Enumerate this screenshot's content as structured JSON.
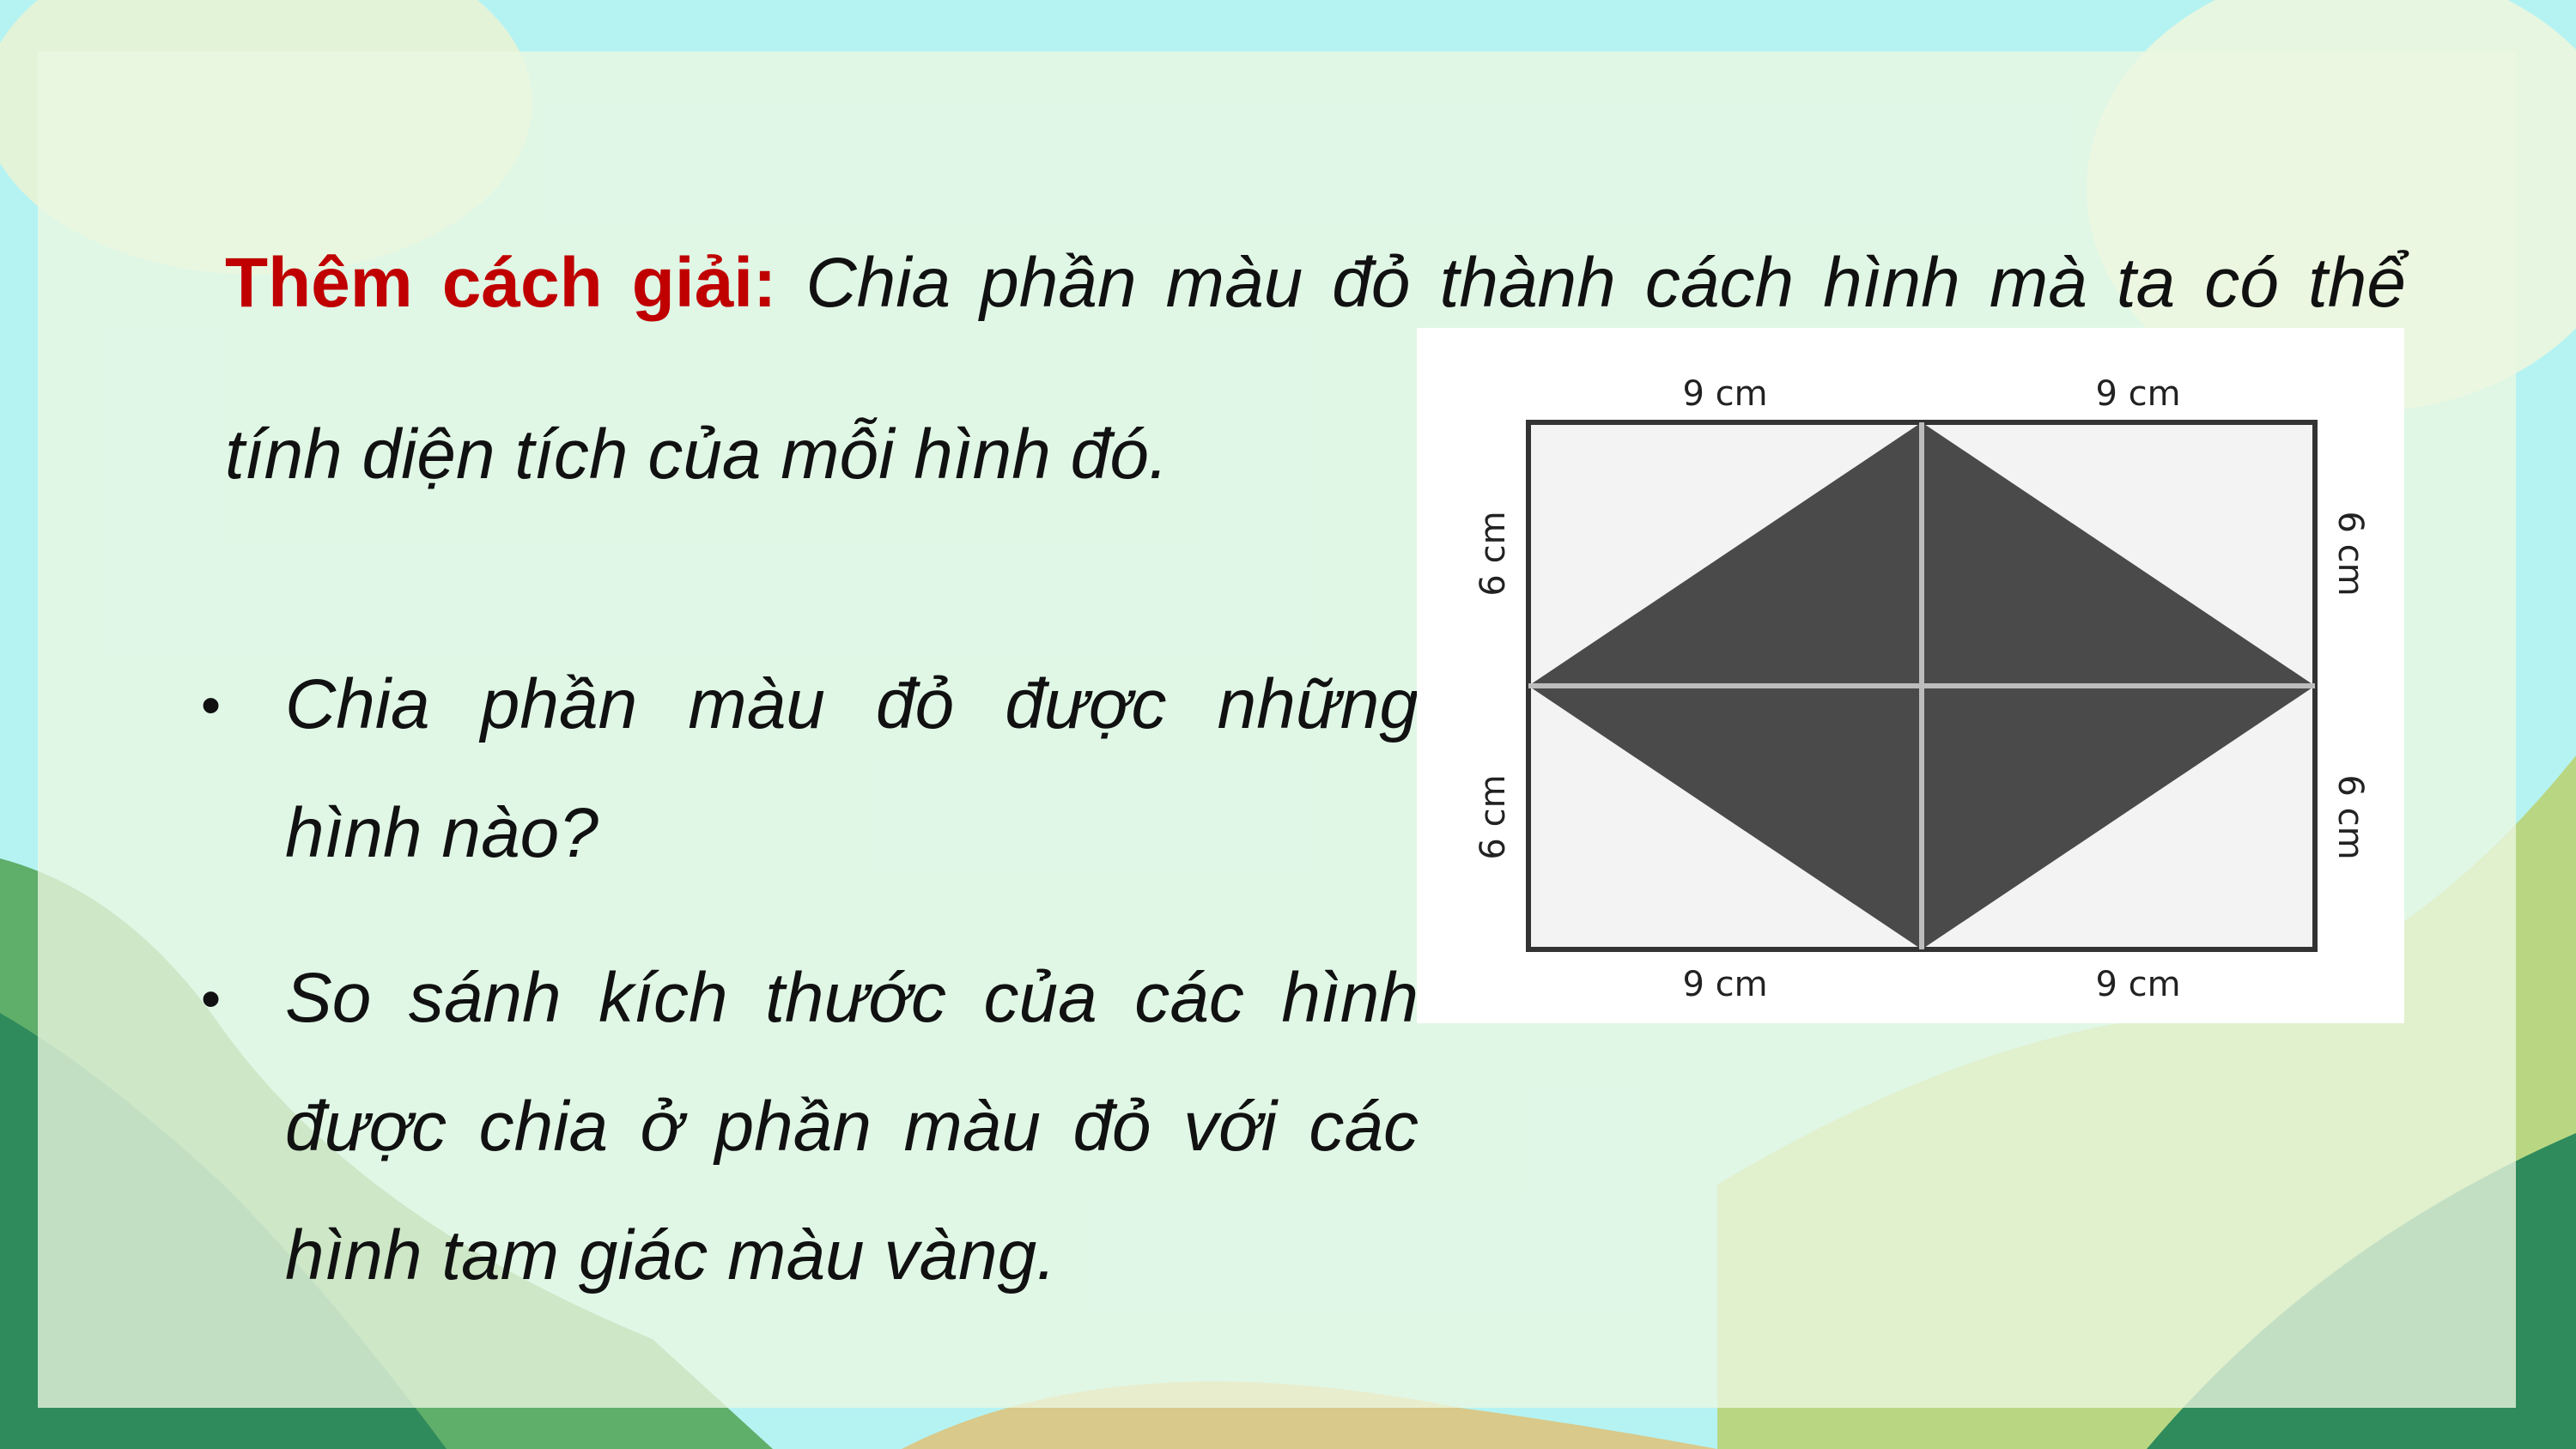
{
  "intro": {
    "highlight": "Thêm cách giải:",
    "text": "Chia phần màu đỏ thành cách hình mà ta có thể tính diện tích của mỗi hình đó."
  },
  "bullets": [
    {
      "marker": "•",
      "text": "Chia phần màu đỏ được những hình nào?"
    },
    {
      "marker": "•",
      "text": "So sánh kích thước của các hình được chia ở phần màu đỏ với các hình tam giác màu vàng."
    }
  ],
  "figure": {
    "top_left": "9 cm",
    "top_right": "9 cm",
    "bottom_left": "9 cm",
    "bottom_right": "9 cm",
    "left_top": "6 cm",
    "left_bottom": "6 cm",
    "right_top": "6 cm",
    "right_bottom": "6 cm"
  },
  "colors": {
    "highlight": "#c00000",
    "rhombus": "#4a4a4a",
    "rect_fill": "#f3f3f3"
  }
}
